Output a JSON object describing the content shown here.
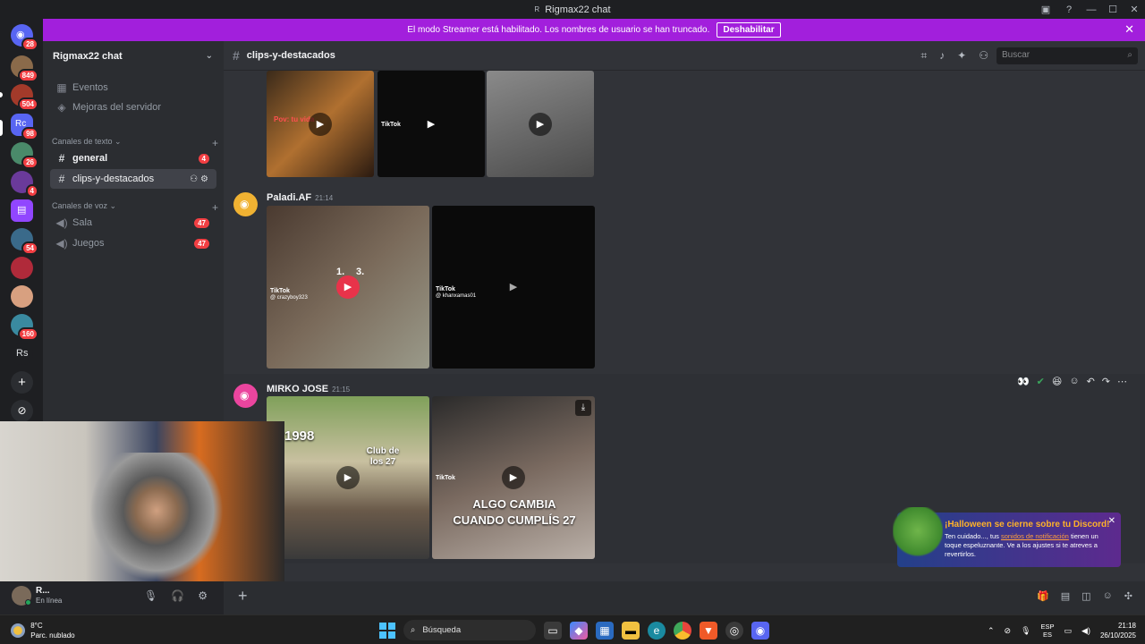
{
  "window": {
    "title": "Rigmax22 chat",
    "logo_text": "R"
  },
  "banner": {
    "message": "El modo Streamer está habilitado. Los nombres de usuario se han truncado.",
    "button_label": "Deshabilitar",
    "close_glyph": "✕"
  },
  "rail": {
    "servers": [
      {
        "name": "discord-home",
        "badge": "28",
        "color": "#5865f2",
        "text": ""
      },
      {
        "name": "server-1",
        "badge": "849",
        "color": "#8a6a4a",
        "text": ""
      },
      {
        "name": "server-2",
        "badge": "504",
        "color": "#a33a2a",
        "text": ""
      },
      {
        "name": "server-rc",
        "badge": "98",
        "color": "#5865f2",
        "text": "Rc"
      },
      {
        "name": "server-4",
        "badge": "26",
        "color": "#4a8a6a",
        "text": ""
      },
      {
        "name": "server-5",
        "badge": "4",
        "color": "#6a3a9a",
        "text": ""
      },
      {
        "name": "twitch",
        "badge": "",
        "color": "#9146ff",
        "text": ""
      },
      {
        "name": "server-7",
        "badge": "54",
        "color": "#3a6a8a",
        "text": ""
      },
      {
        "name": "server-8",
        "badge": "",
        "color": "#b02a3a",
        "text": ""
      },
      {
        "name": "server-9",
        "badge": "",
        "color": "#d8a080",
        "text": ""
      },
      {
        "name": "server-10",
        "badge": "160",
        "color": "#3a8aa0",
        "text": ""
      },
      {
        "name": "server-rs",
        "badge": "",
        "color": "#1e1f22",
        "text": "Rs"
      }
    ],
    "add_glyph": "+",
    "explore_glyph": "⊘"
  },
  "sidebar": {
    "server_name": "Rigmax22 chat",
    "events_label": "Eventos",
    "boost_label": "Mejoras del servidor",
    "text_category": "Canales de texto",
    "voice_category": "Canales de voz",
    "text_channels": [
      {
        "name": "general",
        "badge": "4"
      },
      {
        "name": "clips-y-destacados",
        "badge": ""
      }
    ],
    "voice_channels": [
      {
        "name": "Sala",
        "badge": "47"
      },
      {
        "name": "Juegos",
        "badge": "47"
      }
    ]
  },
  "channel": {
    "name": "clips-y-destacados",
    "search_placeholder": "Buscar"
  },
  "messages": [
    {
      "author": "Paladi.AF",
      "time": "21:14",
      "tiktok_user_a": "@ crazyboy323",
      "tiktok_user_b": "@ khanxamas01",
      "overlay_a": "1.",
      "overlay_b": "3."
    },
    {
      "author": "MIRKO JOSE",
      "time": "21:15",
      "caption_year": "1998",
      "caption_club": "Club de los 27",
      "caption_main": "ALGO CAMBIA CUANDO CUMPLÍS 27",
      "tiktok_label": "TikTok"
    }
  ],
  "top_clips": {
    "tiktok_label": "TikTok",
    "caption_left": "Pov: tu vida"
  },
  "composer": {
    "add_glyph": "+"
  },
  "user": {
    "name": "R...",
    "status": "En línea"
  },
  "toast": {
    "title": "¡Halloween se cierne sobre tu Discord!",
    "body_prefix": "Ten cuidado..., tus ",
    "link": "sonidos de notificación",
    "body_suffix": " tienen un toque espeluznante. Ve a los ajustes si te atreves a revertirlos.",
    "close_glyph": "✕"
  },
  "taskbar": {
    "temp": "8°C",
    "weather": "Parc. nublado",
    "search_label": "Búsqueda",
    "lang_top": "ESP",
    "lang_bottom": "ES",
    "time": "21:18",
    "date": "26/10/2025"
  }
}
